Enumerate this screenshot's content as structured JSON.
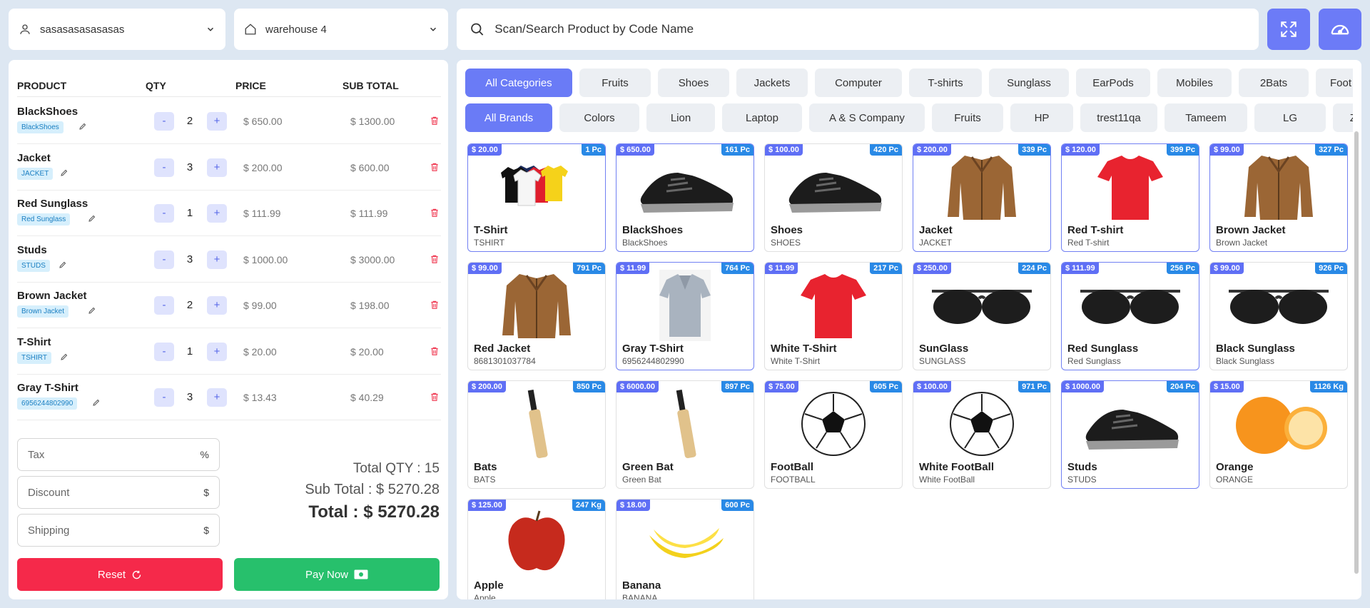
{
  "header": {
    "customer": "sasasasasasasas",
    "warehouse": "warehouse 4",
    "search_placeholder": "Scan/Search Product by Code Name"
  },
  "cart": {
    "columns": [
      "PRODUCT",
      "QTY",
      "PRICE",
      "SUB TOTAL"
    ],
    "items": [
      {
        "name": "BlackShoes",
        "code": "BlackShoes",
        "qty": "2",
        "price": "$ 650.00",
        "subtotal": "$ 1300.00"
      },
      {
        "name": "Jacket",
        "code": "JACKET",
        "qty": "3",
        "price": "$ 200.00",
        "subtotal": "$ 600.00"
      },
      {
        "name": "Red Sunglass",
        "code": "Red Sunglass",
        "qty": "1",
        "price": "$ 111.99",
        "subtotal": "$ 111.99"
      },
      {
        "name": "Studs",
        "code": "STUDS",
        "qty": "3",
        "price": "$ 1000.00",
        "subtotal": "$ 3000.00"
      },
      {
        "name": "Brown Jacket",
        "code": "Brown Jacket",
        "qty": "2",
        "price": "$ 99.00",
        "subtotal": "$ 198.00"
      },
      {
        "name": "T-Shirt",
        "code": "TSHIRT",
        "qty": "1",
        "price": "$ 20.00",
        "subtotal": "$ 20.00"
      },
      {
        "name": "Gray T-Shirt",
        "code": "6956244802990",
        "qty": "3",
        "price": "$ 13.43",
        "subtotal": "$ 40.29"
      }
    ],
    "minus_label": "-",
    "plus_label": "+",
    "edit_glyph": "✎",
    "tax_placeholder": "Tax",
    "tax_unit": "%",
    "discount_placeholder": "Discount",
    "discount_unit": "$",
    "shipping_placeholder": "Shipping",
    "shipping_unit": "$",
    "total_qty": "Total QTY : 15",
    "sub_total": "Sub Total : $ 5270.28",
    "total": "Total : $ 5270.28",
    "reset_label": "Reset",
    "pay_label": "Pay Now"
  },
  "categories": [
    "All Categories",
    "Fruits",
    "Shoes",
    "Jackets",
    "Computer",
    "T-shirts",
    "Sunglass",
    "EarPods",
    "Mobiles",
    "2Bats",
    "Foot"
  ],
  "brands": [
    "All Brands",
    "Colors",
    "Lion",
    "Laptop",
    "A & S Company",
    "Fruits",
    "HP",
    "trest11qa",
    "Tameem",
    "LG",
    "Zar"
  ],
  "products": [
    {
      "name": "T-Shirt",
      "code": "TSHIRT",
      "price": "$ 20.00",
      "stock": "1 Pc",
      "image": "tshirts-icon"
    },
    {
      "name": "BlackShoes",
      "code": "BlackShoes",
      "price": "$ 650.00",
      "stock": "161 Pc",
      "image": "shoe-icon"
    },
    {
      "name": "Shoes",
      "code": "SHOES",
      "price": "$ 100.00",
      "stock": "420 Pc",
      "image": "shoe-icon"
    },
    {
      "name": "Jacket",
      "code": "JACKET",
      "price": "$ 200.00",
      "stock": "339 Pc",
      "image": "jacket-icon"
    },
    {
      "name": "Red T-shirt",
      "code": "Red T-shirt",
      "price": "$ 120.00",
      "stock": "399 Pc",
      "image": "tshirt-icon"
    },
    {
      "name": "Brown Jacket",
      "code": "Brown Jacket",
      "price": "$ 99.00",
      "stock": "327 Pc",
      "image": "jacket-icon"
    },
    {
      "name": "Red Jacket",
      "code": "8681301037784",
      "price": "$ 99.00",
      "stock": "791 Pc",
      "image": "jacket-icon"
    },
    {
      "name": "Gray T-Shirt",
      "code": "6956244802990",
      "price": "$ 11.99",
      "stock": "764 Pc",
      "image": "polo-icon"
    },
    {
      "name": "White T-Shirt",
      "code": "White T-Shirt",
      "price": "$ 11.99",
      "stock": "217 Pc",
      "image": "tshirt-icon"
    },
    {
      "name": "SunGlass",
      "code": "SUNGLASS",
      "price": "$ 250.00",
      "stock": "224 Pc",
      "image": "sunglass-icon"
    },
    {
      "name": "Red Sunglass",
      "code": "Red Sunglass",
      "price": "$ 111.99",
      "stock": "256 Pc",
      "image": "sunglass-icon"
    },
    {
      "name": "Black Sunglass",
      "code": "Black Sunglass",
      "price": "$ 99.00",
      "stock": "926 Pc",
      "image": "sunglass-icon"
    },
    {
      "name": "Bats",
      "code": "BATS",
      "price": "$ 200.00",
      "stock": "850 Pc",
      "image": "bat-icon"
    },
    {
      "name": "Green Bat",
      "code": "Green Bat",
      "price": "$ 6000.00",
      "stock": "897 Pc",
      "image": "bat-icon"
    },
    {
      "name": "FootBall",
      "code": "FOOTBALL",
      "price": "$ 75.00",
      "stock": "605 Pc",
      "image": "football-icon"
    },
    {
      "name": "White FootBall",
      "code": "White FootBall",
      "price": "$ 100.00",
      "stock": "971 Pc",
      "image": "football-icon"
    },
    {
      "name": "Studs",
      "code": "STUDS",
      "price": "$ 1000.00",
      "stock": "204 Pc",
      "image": "shoe-icon"
    },
    {
      "name": "Orange",
      "code": "ORANGE",
      "price": "$ 15.00",
      "stock": "1126 Kg",
      "image": "orange-icon"
    },
    {
      "name": "Apple",
      "code": "Apple",
      "price": "$ 125.00",
      "stock": "247 Kg",
      "image": "apple-icon"
    },
    {
      "name": "Banana",
      "code": "BANANA",
      "price": "$ 18.00",
      "stock": "600 Pc",
      "image": "banana-icon"
    }
  ],
  "colors": {
    "primary": "#6a7bf6",
    "reset": "#f5294a",
    "pay": "#27c06c",
    "stock_badge": "#2989e6"
  }
}
